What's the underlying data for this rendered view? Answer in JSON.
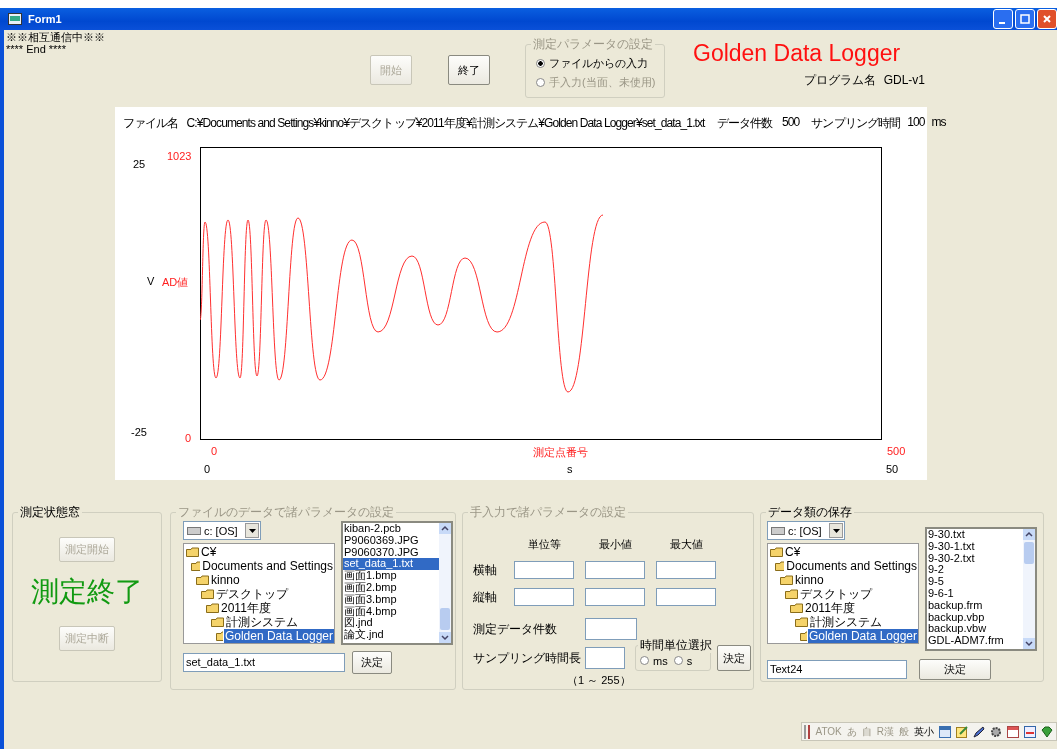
{
  "window": {
    "title": "Form1"
  },
  "status_lines": [
    "※※相互通信中※※",
    "**** End ****"
  ],
  "top_buttons": [
    {
      "label": "開始",
      "disabled": true
    },
    {
      "label": "終了",
      "disabled": false
    }
  ],
  "input_mode": {
    "legend": "測定パラメータの設定",
    "disabled": true,
    "options": [
      {
        "label": "ファイルからの入力",
        "selected": true,
        "disabled": false
      },
      {
        "label": "手入力(当面、未使用)",
        "selected": false,
        "disabled": true
      }
    ]
  },
  "app_title": "Golden Data Logger",
  "program_name": {
    "label": "プログラム名",
    "value": "GDL-v1"
  },
  "chart": {
    "file_label": "ファイル名",
    "file_path": "C:¥Documents and Settings¥kinno¥デスクトップ¥2011年度¥計測システム¥Golden Data Logger¥set_data_1.txt",
    "count_label": "データ件数",
    "count": "500",
    "sampling_label": "サンプリング時間",
    "sampling_value": "100",
    "sampling_unit": "ms",
    "y_volts": {
      "max": "25",
      "label": "V",
      "min": "-25"
    },
    "y_ad": {
      "max": "1023",
      "label": "AD値",
      "min": "0"
    },
    "x_points": {
      "min": "0",
      "label": "測定点番号",
      "max": "500"
    },
    "x_time": {
      "min": "0",
      "label": "s",
      "max": "50"
    }
  },
  "status_group": {
    "legend": "測定状態窓",
    "start_button": {
      "label": "測定開始",
      "disabled": true
    },
    "status": "測定終了",
    "stop_button": {
      "label": "測定中断",
      "disabled": true
    }
  },
  "file_settings": {
    "legend": "ファイルのデータで諸パラメータの設定",
    "disabled": true,
    "drive": "c: [OS]",
    "tree": [
      {
        "label": "C¥",
        "selected": false,
        "children": [
          {
            "label": "Documents and Settings",
            "selected": false,
            "children": [
              {
                "label": "kinno",
                "selected": false,
                "children": [
                  {
                    "label": "デスクトップ",
                    "selected": false,
                    "children": [
                      {
                        "label": "2011年度",
                        "selected": false,
                        "children": [
                          {
                            "label": "計測システム",
                            "selected": false,
                            "children": [
                              {
                                "label": "Golden Data Logger",
                                "selected": true
                              }
                            ]
                          }
                        ]
                      }
                    ]
                  }
                ]
              }
            ]
          }
        ]
      }
    ],
    "files": [
      {
        "label": "kiban-2.pcb",
        "selected": false
      },
      {
        "label": "P9060369.JPG",
        "selected": false
      },
      {
        "label": "P9060370.JPG",
        "selected": false
      },
      {
        "label": "set_data_1.txt",
        "selected": true
      },
      {
        "label": "画面1.bmp",
        "selected": false
      },
      {
        "label": "画面2.bmp",
        "selected": false
      },
      {
        "label": "画面3.bmp",
        "selected": false
      },
      {
        "label": "画面4.bmp",
        "selected": false
      },
      {
        "label": "図.jnd",
        "selected": false
      },
      {
        "label": "論文.jnd",
        "selected": false
      }
    ],
    "filename": "set_data_1.txt",
    "ok": "決定"
  },
  "manual_settings": {
    "legend": "手入力で諸パラメータの設定",
    "disabled": true,
    "columns": [
      "単位等",
      "最小値",
      "最大値"
    ],
    "axes": [
      "横軸",
      "縦軸"
    ],
    "count_label": "測定データ件数",
    "sampling_label": "サンプリング時間長",
    "range": "（1 ～ 255）",
    "unit_group": {
      "legend": "時間単位選択",
      "options": [
        {
          "label": "ms",
          "selected": false
        },
        {
          "label": "s",
          "selected": false
        }
      ]
    },
    "ok": "決定"
  },
  "save_settings": {
    "legend": "データ類の保存",
    "disabled": false,
    "drive": "c: [OS]",
    "tree": [
      {
        "label": "C¥",
        "selected": false,
        "children": [
          {
            "label": "Documents and Settings",
            "selected": false,
            "children": [
              {
                "label": "kinno",
                "selected": false,
                "children": [
                  {
                    "label": "デスクトップ",
                    "selected": false,
                    "children": [
                      {
                        "label": "2011年度",
                        "selected": false,
                        "children": [
                          {
                            "label": "計測システム",
                            "selected": false,
                            "children": [
                              {
                                "label": "Golden Data Logger",
                                "selected": true
                              }
                            ]
                          }
                        ]
                      }
                    ]
                  }
                ]
              }
            ]
          }
        ]
      }
    ],
    "files": [
      {
        "label": "9-30.txt",
        "selected": false
      },
      {
        "label": "9-30-1.txt",
        "selected": false
      },
      {
        "label": "9-30-2.txt",
        "selected": false
      },
      {
        "label": "9-2",
        "selected": false
      },
      {
        "label": "9-5",
        "selected": false
      },
      {
        "label": "9-6-1",
        "selected": false
      },
      {
        "label": "backup.frm",
        "selected": false
      },
      {
        "label": "backup.vbp",
        "selected": false
      },
      {
        "label": "backup.vbw",
        "selected": false
      },
      {
        "label": "GDL-ADM7.frm",
        "selected": false
      }
    ],
    "filename": "Text24",
    "ok": "決定"
  },
  "ime_bar": [
    {
      "label": "ATOK",
      "disabled": true
    },
    {
      "label": "あ",
      "disabled": true
    },
    {
      "label": "自",
      "disabled": true
    },
    {
      "label": "R漢",
      "disabled": true
    },
    {
      "label": "般",
      "disabled": true
    },
    {
      "label": "英小",
      "disabled": false
    }
  ]
}
